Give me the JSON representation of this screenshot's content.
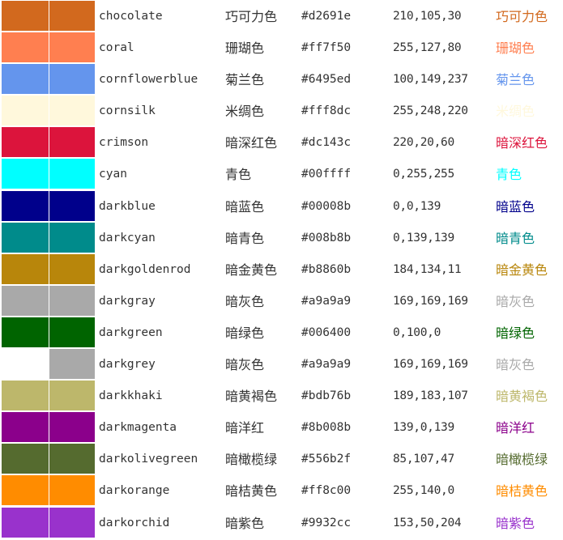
{
  "colors": [
    {
      "name": "chocolate",
      "cn": "巧可力色",
      "hex": "#d2691e",
      "rgb": "210,105,30",
      "swatch_a": "#d2691e",
      "swatch_b": "#d2691e"
    },
    {
      "name": "coral",
      "cn": "珊瑚色",
      "hex": "#ff7f50",
      "rgb": "255,127,80",
      "swatch_a": "#ff7f50",
      "swatch_b": "#ff7f50"
    },
    {
      "name": "cornflowerblue",
      "cn": "菊兰色",
      "hex": "#6495ed",
      "rgb": "100,149,237",
      "swatch_a": "#6495ed",
      "swatch_b": "#6495ed"
    },
    {
      "name": "cornsilk",
      "cn": "米绸色",
      "hex": "#fff8dc",
      "rgb": "255,248,220",
      "swatch_a": "#fff8dc",
      "swatch_b": "#fff8dc"
    },
    {
      "name": "crimson",
      "cn": "暗深红色",
      "hex": "#dc143c",
      "rgb": "220,20,60",
      "swatch_a": "#dc143c",
      "swatch_b": "#dc143c"
    },
    {
      "name": "cyan",
      "cn": "青色",
      "hex": "#00ffff",
      "rgb": "0,255,255",
      "swatch_a": "#00ffff",
      "swatch_b": "#00ffff"
    },
    {
      "name": "darkblue",
      "cn": "暗蓝色",
      "hex": "#00008b",
      "rgb": "0,0,139",
      "swatch_a": "#00008b",
      "swatch_b": "#00008b"
    },
    {
      "name": "darkcyan",
      "cn": "暗青色",
      "hex": "#008b8b",
      "rgb": "0,139,139",
      "swatch_a": "#008b8b",
      "swatch_b": "#008b8b"
    },
    {
      "name": "darkgoldenrod",
      "cn": "暗金黄色",
      "hex": "#b8860b",
      "rgb": "184,134,11",
      "swatch_a": "#b8860b",
      "swatch_b": "#b8860b"
    },
    {
      "name": "darkgray",
      "cn": "暗灰色",
      "hex": "#a9a9a9",
      "rgb": "169,169,169",
      "swatch_a": "#a9a9a9",
      "swatch_b": "#a9a9a9"
    },
    {
      "name": "darkgreen",
      "cn": "暗绿色",
      "hex": "#006400",
      "rgb": "0,100,0",
      "swatch_a": "#006400",
      "swatch_b": "#006400"
    },
    {
      "name": "darkgrey",
      "cn": "暗灰色",
      "hex": "#a9a9a9",
      "rgb": "169,169,169",
      "swatch_a": "#ffffff",
      "swatch_b": "#a9a9a9"
    },
    {
      "name": "darkkhaki",
      "cn": "暗黄褐色",
      "hex": "#bdb76b",
      "rgb": "189,183,107",
      "swatch_a": "#bdb76b",
      "swatch_b": "#bdb76b"
    },
    {
      "name": "darkmagenta",
      "cn": "暗洋红",
      "hex": "#8b008b",
      "rgb": "139,0,139",
      "swatch_a": "#8b008b",
      "swatch_b": "#8b008b"
    },
    {
      "name": "darkolivegreen",
      "cn": "暗橄榄绿",
      "hex": "#556b2f",
      "rgb": "85,107,47",
      "swatch_a": "#556b2f",
      "swatch_b": "#556b2f"
    },
    {
      "name": "darkorange",
      "cn": "暗桔黄色",
      "hex": "#ff8c00",
      "rgb": "255,140,0",
      "swatch_a": "#ff8c00",
      "swatch_b": "#ff8c00"
    },
    {
      "name": "darkorchid",
      "cn": "暗紫色",
      "hex": "#9932cc",
      "rgb": "153,50,204",
      "swatch_a": "#9932cc",
      "swatch_b": "#9932cc"
    }
  ]
}
